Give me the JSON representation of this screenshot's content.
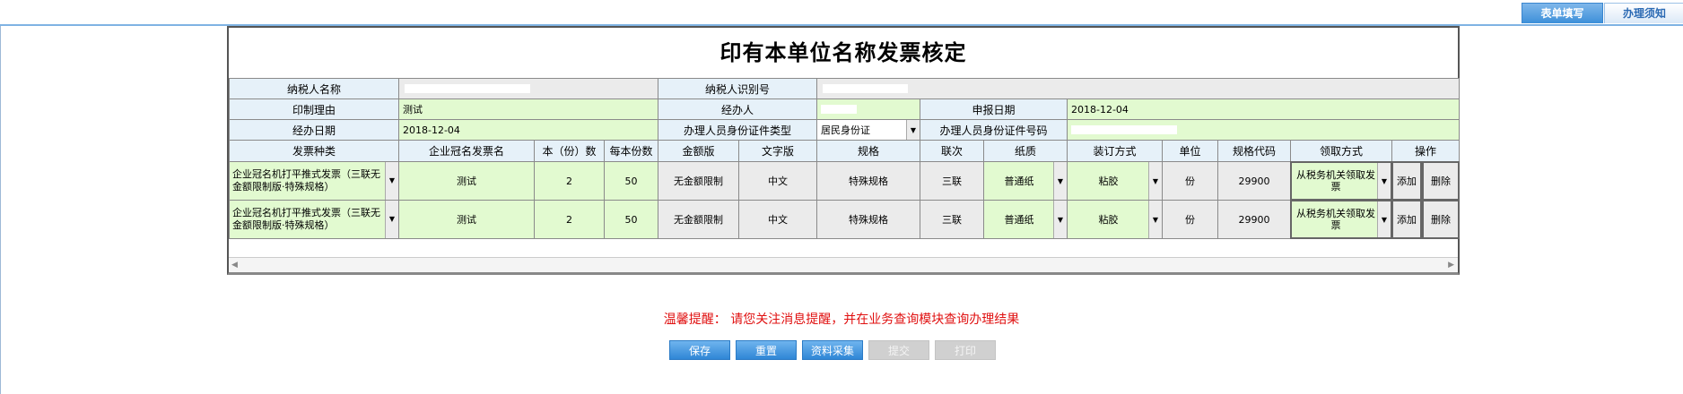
{
  "tabs": {
    "active": "表单填写",
    "inactive": "办理须知"
  },
  "form": {
    "title": "印有本单位名称发票核定",
    "taxpayer_name_label": "纳税人名称",
    "taxpayer_id_label": "纳税人识别号",
    "print_reason_label": "印制理由",
    "print_reason_value": "测试",
    "handler_label": "经办人",
    "declare_date_label": "申报日期",
    "declare_date_value": "2018-12-04",
    "handle_date_label": "经办日期",
    "handle_date_value": "2018-12-04",
    "id_type_label": "办理人员身份证件类型",
    "id_type_value": "居民身份证",
    "id_number_label": "办理人员身份证件号码"
  },
  "table": {
    "headers": [
      "发票种类",
      "企业冠名发票名",
      "本（份）数",
      "每本份数",
      "金额版",
      "文字版",
      "规格",
      "联次",
      "纸质",
      "装订方式",
      "单位",
      "规格代码",
      "领取方式",
      "操作"
    ],
    "rows": [
      {
        "type": "企业冠名机打平推式发票（三联无金额限制版·特殊规格）",
        "name": "测试",
        "count": "2",
        "per": "50",
        "amount": "无金额限制",
        "text": "中文",
        "spec": "特殊规格",
        "copies": "三联",
        "paper": "普通纸",
        "binding": "粘胶",
        "unit": "份",
        "code": "29900",
        "method": "从税务机关领取发票",
        "add": "添加",
        "del": "删除"
      },
      {
        "type": "企业冠名机打平推式发票（三联无金额限制版·特殊规格）",
        "name": "测试",
        "count": "2",
        "per": "50",
        "amount": "无金额限制",
        "text": "中文",
        "spec": "特殊规格",
        "copies": "三联",
        "paper": "普通纸",
        "binding": "粘胶",
        "unit": "份",
        "code": "29900",
        "method": "从税务机关领取发票",
        "add": "添加",
        "del": "删除"
      }
    ]
  },
  "reminder": "温馨提醒：  请您关注消息提醒，并在业务查询模块查询办理结果",
  "buttons": {
    "save": "保存",
    "reset": "重置",
    "collect": "资料采集",
    "submit": "提交",
    "print": "打印"
  },
  "colors": {
    "label_bg": "#e6f1f9",
    "field_bg": "#e2fad0",
    "button_blue": "#2f86d6",
    "reminder_red": "#e01010"
  }
}
